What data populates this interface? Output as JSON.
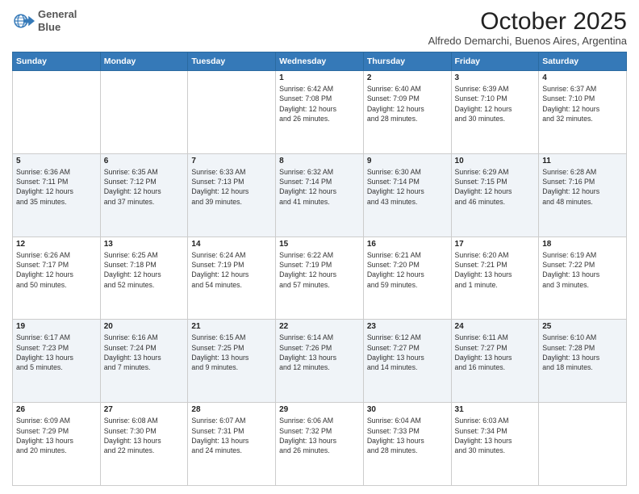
{
  "logo": {
    "line1": "General",
    "line2": "Blue"
  },
  "title": "October 2025",
  "subtitle": "Alfredo Demarchi, Buenos Aires, Argentina",
  "days_of_week": [
    "Sunday",
    "Monday",
    "Tuesday",
    "Wednesday",
    "Thursday",
    "Friday",
    "Saturday"
  ],
  "weeks": [
    [
      {
        "day": "",
        "info": ""
      },
      {
        "day": "",
        "info": ""
      },
      {
        "day": "",
        "info": ""
      },
      {
        "day": "1",
        "info": "Sunrise: 6:42 AM\nSunset: 7:08 PM\nDaylight: 12 hours\nand 26 minutes."
      },
      {
        "day": "2",
        "info": "Sunrise: 6:40 AM\nSunset: 7:09 PM\nDaylight: 12 hours\nand 28 minutes."
      },
      {
        "day": "3",
        "info": "Sunrise: 6:39 AM\nSunset: 7:10 PM\nDaylight: 12 hours\nand 30 minutes."
      },
      {
        "day": "4",
        "info": "Sunrise: 6:37 AM\nSunset: 7:10 PM\nDaylight: 12 hours\nand 32 minutes."
      }
    ],
    [
      {
        "day": "5",
        "info": "Sunrise: 6:36 AM\nSunset: 7:11 PM\nDaylight: 12 hours\nand 35 minutes."
      },
      {
        "day": "6",
        "info": "Sunrise: 6:35 AM\nSunset: 7:12 PM\nDaylight: 12 hours\nand 37 minutes."
      },
      {
        "day": "7",
        "info": "Sunrise: 6:33 AM\nSunset: 7:13 PM\nDaylight: 12 hours\nand 39 minutes."
      },
      {
        "day": "8",
        "info": "Sunrise: 6:32 AM\nSunset: 7:14 PM\nDaylight: 12 hours\nand 41 minutes."
      },
      {
        "day": "9",
        "info": "Sunrise: 6:30 AM\nSunset: 7:14 PM\nDaylight: 12 hours\nand 43 minutes."
      },
      {
        "day": "10",
        "info": "Sunrise: 6:29 AM\nSunset: 7:15 PM\nDaylight: 12 hours\nand 46 minutes."
      },
      {
        "day": "11",
        "info": "Sunrise: 6:28 AM\nSunset: 7:16 PM\nDaylight: 12 hours\nand 48 minutes."
      }
    ],
    [
      {
        "day": "12",
        "info": "Sunrise: 6:26 AM\nSunset: 7:17 PM\nDaylight: 12 hours\nand 50 minutes."
      },
      {
        "day": "13",
        "info": "Sunrise: 6:25 AM\nSunset: 7:18 PM\nDaylight: 12 hours\nand 52 minutes."
      },
      {
        "day": "14",
        "info": "Sunrise: 6:24 AM\nSunset: 7:19 PM\nDaylight: 12 hours\nand 54 minutes."
      },
      {
        "day": "15",
        "info": "Sunrise: 6:22 AM\nSunset: 7:19 PM\nDaylight: 12 hours\nand 57 minutes."
      },
      {
        "day": "16",
        "info": "Sunrise: 6:21 AM\nSunset: 7:20 PM\nDaylight: 12 hours\nand 59 minutes."
      },
      {
        "day": "17",
        "info": "Sunrise: 6:20 AM\nSunset: 7:21 PM\nDaylight: 13 hours\nand 1 minute."
      },
      {
        "day": "18",
        "info": "Sunrise: 6:19 AM\nSunset: 7:22 PM\nDaylight: 13 hours\nand 3 minutes."
      }
    ],
    [
      {
        "day": "19",
        "info": "Sunrise: 6:17 AM\nSunset: 7:23 PM\nDaylight: 13 hours\nand 5 minutes."
      },
      {
        "day": "20",
        "info": "Sunrise: 6:16 AM\nSunset: 7:24 PM\nDaylight: 13 hours\nand 7 minutes."
      },
      {
        "day": "21",
        "info": "Sunrise: 6:15 AM\nSunset: 7:25 PM\nDaylight: 13 hours\nand 9 minutes."
      },
      {
        "day": "22",
        "info": "Sunrise: 6:14 AM\nSunset: 7:26 PM\nDaylight: 13 hours\nand 12 minutes."
      },
      {
        "day": "23",
        "info": "Sunrise: 6:12 AM\nSunset: 7:27 PM\nDaylight: 13 hours\nand 14 minutes."
      },
      {
        "day": "24",
        "info": "Sunrise: 6:11 AM\nSunset: 7:27 PM\nDaylight: 13 hours\nand 16 minutes."
      },
      {
        "day": "25",
        "info": "Sunrise: 6:10 AM\nSunset: 7:28 PM\nDaylight: 13 hours\nand 18 minutes."
      }
    ],
    [
      {
        "day": "26",
        "info": "Sunrise: 6:09 AM\nSunset: 7:29 PM\nDaylight: 13 hours\nand 20 minutes."
      },
      {
        "day": "27",
        "info": "Sunrise: 6:08 AM\nSunset: 7:30 PM\nDaylight: 13 hours\nand 22 minutes."
      },
      {
        "day": "28",
        "info": "Sunrise: 6:07 AM\nSunset: 7:31 PM\nDaylight: 13 hours\nand 24 minutes."
      },
      {
        "day": "29",
        "info": "Sunrise: 6:06 AM\nSunset: 7:32 PM\nDaylight: 13 hours\nand 26 minutes."
      },
      {
        "day": "30",
        "info": "Sunrise: 6:04 AM\nSunset: 7:33 PM\nDaylight: 13 hours\nand 28 minutes."
      },
      {
        "day": "31",
        "info": "Sunrise: 6:03 AM\nSunset: 7:34 PM\nDaylight: 13 hours\nand 30 minutes."
      },
      {
        "day": "",
        "info": ""
      }
    ]
  ]
}
